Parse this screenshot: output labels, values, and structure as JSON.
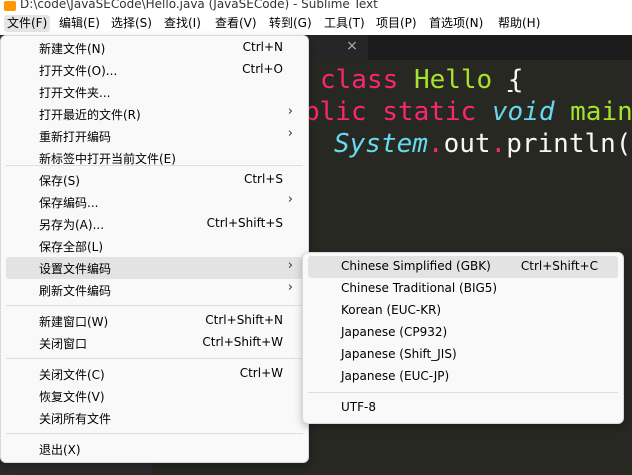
{
  "window": {
    "title": "D:\\code\\JavaSECode\\Hello.java (JavaSECode) - Sublime Text"
  },
  "menubar": {
    "items": [
      {
        "label": "文件(F)",
        "active": true
      },
      {
        "label": "编辑(E)"
      },
      {
        "label": "选择(S)"
      },
      {
        "label": "查找(I)"
      },
      {
        "label": "查看(V)"
      },
      {
        "label": "转到(G)"
      },
      {
        "label": "工具(T)"
      },
      {
        "label": "项目(P)"
      },
      {
        "label": "首选项(N)"
      },
      {
        "label": "帮助(H)"
      }
    ]
  },
  "tab": {
    "close_glyph": "×"
  },
  "editor": {
    "line1": {
      "kw": "class",
      "name": "Hello",
      "brace": "{"
    },
    "line2": {
      "kw1": "blic",
      "kw2": "static",
      "type": "void",
      "fn": "main",
      "rest": "("
    },
    "line3": {
      "obj": "System",
      "dot1": ".",
      "field": "out",
      "dot2": ".",
      "fn": "println",
      "rest": "(\""
    }
  },
  "file_menu": {
    "items": [
      {
        "label": "新建文件(N)",
        "shortcut": "Ctrl+N"
      },
      {
        "label": "打开文件(O)...",
        "shortcut": "Ctrl+O"
      },
      {
        "label": "打开文件夹..."
      },
      {
        "label": "打开最近的文件(R)",
        "submenu": true
      },
      {
        "label": "重新打开编码",
        "submenu": true
      },
      {
        "label": "新标签中打开当前文件(E)"
      },
      {
        "label": "保存(S)",
        "shortcut": "Ctrl+S"
      },
      {
        "label": "保存编码...",
        "submenu": true
      },
      {
        "label": "另存为(A)...",
        "shortcut": "Ctrl+Shift+S"
      },
      {
        "label": "保存全部(L)"
      },
      {
        "label": "设置文件编码",
        "submenu": true,
        "active": true
      },
      {
        "label": "刷新文件编码",
        "submenu": true
      },
      {
        "label": "新建窗口(W)",
        "shortcut": "Ctrl+Shift+N"
      },
      {
        "label": "关闭窗口",
        "shortcut": "Ctrl+Shift+W"
      },
      {
        "label": "关闭文件(C)",
        "shortcut": "Ctrl+W"
      },
      {
        "label": "恢复文件(V)"
      },
      {
        "label": "关闭所有文件"
      },
      {
        "label": "退出(X)"
      }
    ],
    "submenu_arrow": "›"
  },
  "encoding_menu": {
    "items": [
      {
        "label": "Chinese Simplified (GBK)",
        "shortcut": "Ctrl+Shift+C",
        "active": true
      },
      {
        "label": "Chinese Traditional (BIG5)"
      },
      {
        "label": "Korean (EUC-KR)"
      },
      {
        "label": "Japanese (CP932)"
      },
      {
        "label": "Japanese (Shift_JIS)"
      },
      {
        "label": "Japanese (EUC-JP)"
      },
      {
        "label": "UTF-8"
      }
    ]
  },
  "colors": {
    "editor_bg": "#272822",
    "keyword": "#f92672",
    "class_name": "#a6e22e",
    "type": "#66d9ef",
    "menu_bg": "#f9f9f9",
    "menu_active": "#e3e3e3"
  }
}
